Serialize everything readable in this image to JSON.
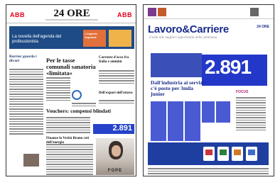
{
  "left_page": {
    "masthead": {
      "ad_left": "ABB",
      "title": "24 ORE",
      "ad_right": "ABB"
    },
    "banner": {
      "title": "La novella dell'agenda del professionista",
      "box_label": "L'esperto risponde"
    },
    "headlines": {
      "main": "Per le tasse comunali sanatoria «limitata»",
      "left": "Barrier guarda i divari",
      "right": "Carrozze d'acco fra Italia e ammini",
      "mid2": "Dell'export dell'ottavo",
      "bottom": "Vouchers: compensi blindati",
      "small": "Finanze lo Verità Bruno ceti dell'energia"
    },
    "figure": "2.891",
    "ad": {
      "brand": "FOPE"
    },
    "colors": {
      "accent_blue": "#1e4b86",
      "highlight_blue": "#2643c9",
      "brand_red": "#e2001a"
    }
  },
  "right_page": {
    "top": {
      "text": ""
    },
    "title": "Lavoro&Carriere",
    "brand": "24 ORE",
    "subtitle": "Guida alle migliori opportunità della settimana",
    "figure": "2.891",
    "headline": "Dall'industria ai servizi: c'è posto per 3mila junior",
    "side_tag": "FOCUS",
    "colors": {
      "title_blue": "#1a2b8a",
      "block_blue": "#2338c9",
      "ad_blue": "#1f3fa0"
    }
  }
}
